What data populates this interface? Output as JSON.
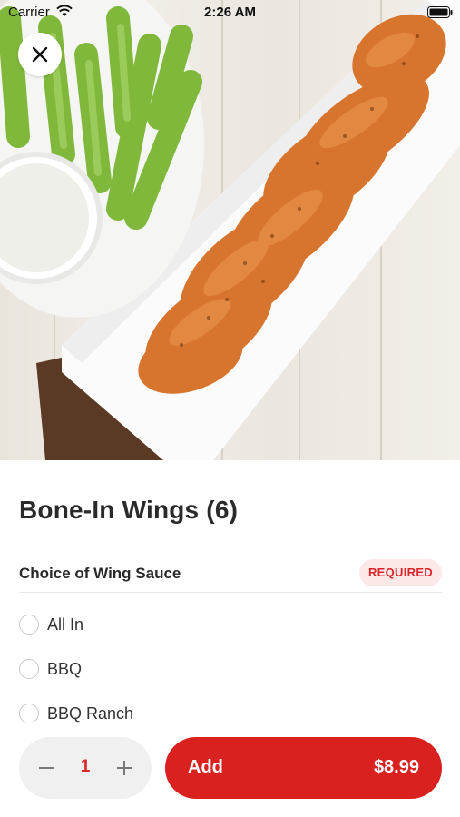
{
  "status_bar": {
    "carrier": "Carrier",
    "time": "2:26 AM"
  },
  "hero": {
    "description_icon": "food-photo"
  },
  "item": {
    "title": "Bone-In Wings (6)"
  },
  "modifier_group": {
    "label": "Choice of Wing Sauce",
    "badge": "REQUIRED",
    "options": [
      {
        "label": "All In",
        "selected": false
      },
      {
        "label": "BBQ",
        "selected": false
      },
      {
        "label": "BBQ Ranch",
        "selected": false
      }
    ]
  },
  "footer": {
    "quantity": "1",
    "add_label": "Add",
    "price": "$8.99"
  },
  "colors": {
    "accent": "#d9221f",
    "badge_bg": "#fde8e8"
  }
}
